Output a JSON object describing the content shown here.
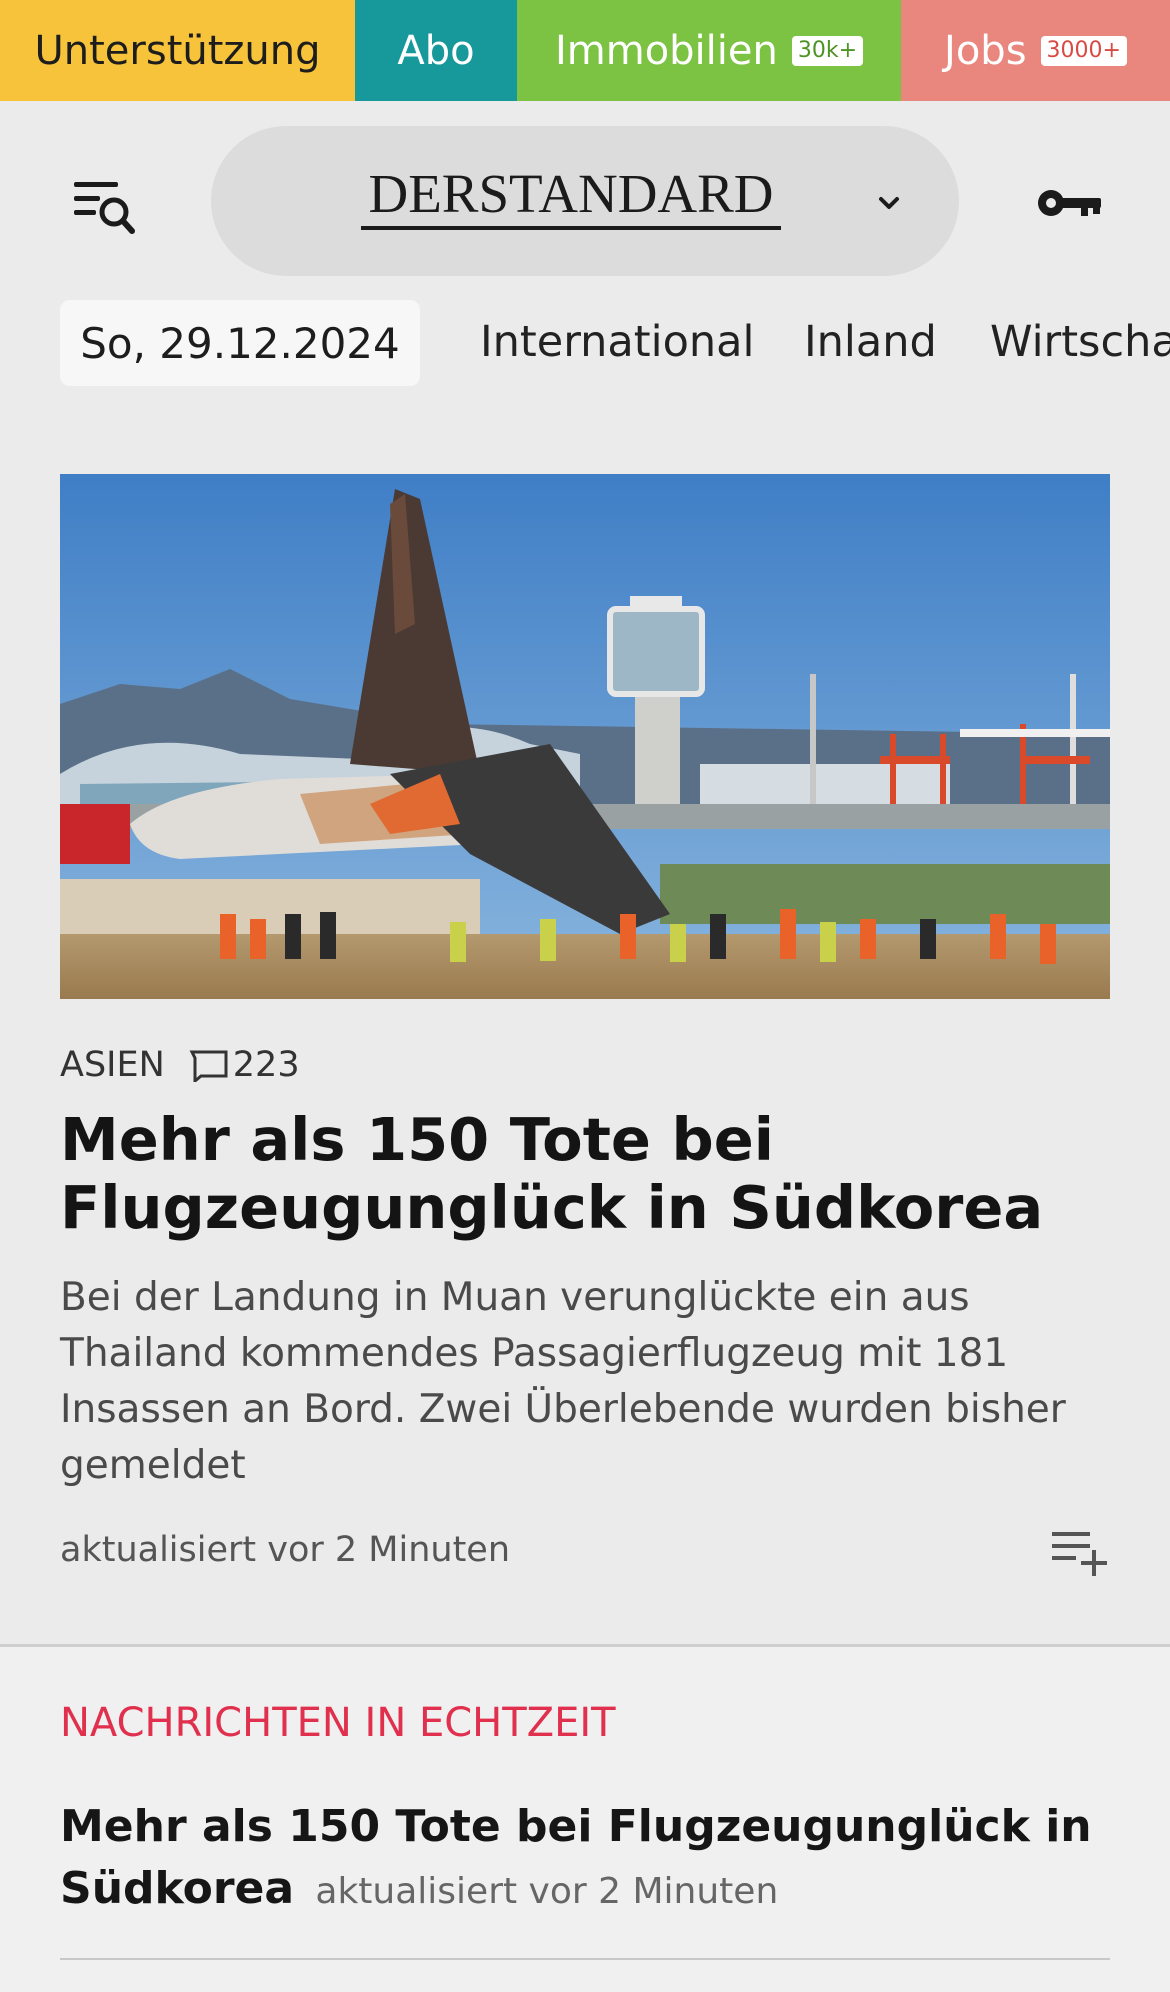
{
  "topbar": {
    "support": "Unterstützung",
    "abo": "Abo",
    "immobilien": "Immobilien",
    "immobilien_badge": "30k+",
    "jobs": "Jobs",
    "jobs_badge": "3000+"
  },
  "header": {
    "logo": "DERSTANDARD"
  },
  "nav": {
    "date": "So, 29.12.2024",
    "items": [
      "International",
      "Inland",
      "Wirtscha"
    ]
  },
  "hero": {
    "category": "ASIEN",
    "comments": "223",
    "headline": "Mehr als 150 Tote bei Flugzeugun­glück in Südkorea",
    "teaser": "Bei der Landung in Muan verunglückte ein aus Thailand kommendes Passagierflugzeug mit 181 Insassen an Bord. Zwei Überlebende wurden bisher gemeldet",
    "updated": "aktualisiert vor 2 Minuten"
  },
  "live": {
    "title": "NACHRICHTEN IN ECHTZEIT",
    "item_headline": "Mehr als 150 Tote bei Flugzeugunglück in Süd­korea",
    "item_time": "aktualisiert vor 2 Minuten"
  },
  "icons": {
    "menu": "menu-search-icon",
    "chevron": "chevron-down-icon",
    "key": "key-icon",
    "comment": "comment-icon",
    "playlist": "playlist-add-icon"
  },
  "colors": {
    "support": "#f7c33b",
    "abo": "#17999c",
    "immobilien": "#7cc243",
    "jobs": "#e9867e",
    "live_title": "#e0304e"
  }
}
